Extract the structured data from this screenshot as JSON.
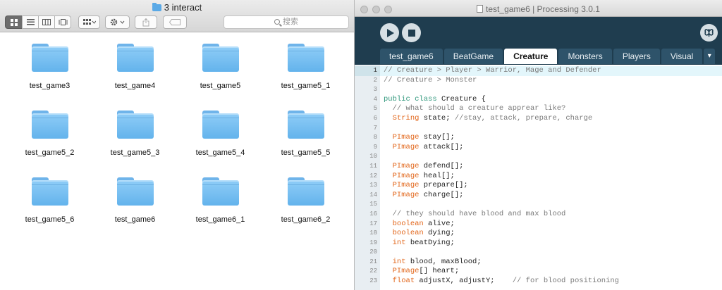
{
  "finder": {
    "title": "3 interact",
    "search_placeholder": "搜索",
    "items": [
      {
        "label": "test_game3"
      },
      {
        "label": "test_game4"
      },
      {
        "label": "test_game5"
      },
      {
        "label": "test_game5_1"
      },
      {
        "label": "test_game5_2"
      },
      {
        "label": "test_game5_3"
      },
      {
        "label": "test_game5_4"
      },
      {
        "label": "test_game5_5"
      },
      {
        "label": "test_game5_6"
      },
      {
        "label": "test_game6"
      },
      {
        "label": "test_game6_1"
      },
      {
        "label": "test_game6_2"
      }
    ],
    "toolbar_icons": [
      "icon-view-icon",
      "list-view-icon",
      "column-view-icon",
      "cover-flow-icon",
      "arrange-icon",
      "action-gear-icon",
      "share-icon",
      "tag-icon"
    ]
  },
  "processing": {
    "title": "test_game6 | Processing 3.0.1",
    "mode_icon": "butterfly-icon",
    "tabs": [
      "test_game6",
      "BeatGame",
      "Creature",
      "Monsters",
      "Players",
      "Visual"
    ],
    "active_tab": "Creature",
    "tab_more": "▾",
    "code_lines": [
      {
        "n": "1",
        "segs": [
          [
            "c-com",
            "// Creature > Player > Warrior, Mage and Defender"
          ]
        ]
      },
      {
        "n": "2",
        "segs": [
          [
            "c-com",
            "// Creature > Monster"
          ]
        ]
      },
      {
        "n": "3",
        "segs": []
      },
      {
        "n": "4",
        "segs": [
          [
            "c-kw",
            "public"
          ],
          [
            "c-tx",
            " "
          ],
          [
            "c-kw",
            "class"
          ],
          [
            "c-tx",
            " Creature {"
          ]
        ]
      },
      {
        "n": "5",
        "segs": [
          [
            "c-tx",
            "  "
          ],
          [
            "c-com",
            "// what should a creature apprear like?"
          ]
        ]
      },
      {
        "n": "6",
        "segs": [
          [
            "c-tx",
            "  "
          ],
          [
            "c-ty",
            "String"
          ],
          [
            "c-tx",
            " state; "
          ],
          [
            "c-com",
            "//stay, attack, prepare, charge"
          ]
        ]
      },
      {
        "n": "7",
        "segs": []
      },
      {
        "n": "8",
        "segs": [
          [
            "c-tx",
            "  "
          ],
          [
            "c-ty",
            "PImage"
          ],
          [
            "c-tx",
            " stay[];"
          ]
        ]
      },
      {
        "n": "9",
        "segs": [
          [
            "c-tx",
            "  "
          ],
          [
            "c-ty",
            "PImage"
          ],
          [
            "c-tx",
            " attack[];"
          ]
        ]
      },
      {
        "n": "10",
        "segs": []
      },
      {
        "n": "11",
        "segs": [
          [
            "c-tx",
            "  "
          ],
          [
            "c-ty",
            "PImage"
          ],
          [
            "c-tx",
            " defend[];"
          ]
        ]
      },
      {
        "n": "12",
        "segs": [
          [
            "c-tx",
            "  "
          ],
          [
            "c-ty",
            "PImage"
          ],
          [
            "c-tx",
            " heal[];"
          ]
        ]
      },
      {
        "n": "13",
        "segs": [
          [
            "c-tx",
            "  "
          ],
          [
            "c-ty",
            "PImage"
          ],
          [
            "c-tx",
            " prepare[];"
          ]
        ]
      },
      {
        "n": "14",
        "segs": [
          [
            "c-tx",
            "  "
          ],
          [
            "c-ty",
            "PImage"
          ],
          [
            "c-tx",
            " charge[];"
          ]
        ]
      },
      {
        "n": "15",
        "segs": []
      },
      {
        "n": "16",
        "segs": [
          [
            "c-tx",
            "  "
          ],
          [
            "c-com",
            "// they should have blood and max blood"
          ]
        ]
      },
      {
        "n": "17",
        "segs": [
          [
            "c-tx",
            "  "
          ],
          [
            "c-ty",
            "boolean"
          ],
          [
            "c-tx",
            " alive;"
          ]
        ]
      },
      {
        "n": "18",
        "segs": [
          [
            "c-tx",
            "  "
          ],
          [
            "c-ty",
            "boolean"
          ],
          [
            "c-tx",
            " dying;"
          ]
        ]
      },
      {
        "n": "19",
        "segs": [
          [
            "c-tx",
            "  "
          ],
          [
            "c-ty",
            "int"
          ],
          [
            "c-tx",
            " beatDying;"
          ]
        ]
      },
      {
        "n": "20",
        "segs": []
      },
      {
        "n": "21",
        "segs": [
          [
            "c-tx",
            "  "
          ],
          [
            "c-ty",
            "int"
          ],
          [
            "c-tx",
            " blood, maxBlood;"
          ]
        ]
      },
      {
        "n": "22",
        "segs": [
          [
            "c-tx",
            "  "
          ],
          [
            "c-ty",
            "PImage"
          ],
          [
            "c-tx",
            "[] heart;"
          ]
        ]
      },
      {
        "n": "23",
        "segs": [
          [
            "c-tx",
            "  "
          ],
          [
            "c-ty",
            "float"
          ],
          [
            "c-tx",
            " adjustX, adjustY;    "
          ],
          [
            "c-com",
            "// for blood positioning"
          ]
        ]
      }
    ]
  },
  "colors": {
    "processing_bg": "#1f3d4f",
    "tab_bg": "#2e536a",
    "keyword": "#33997e",
    "type": "#e2661a",
    "comment": "#7a7a7a",
    "folder": "#63b3ec"
  }
}
